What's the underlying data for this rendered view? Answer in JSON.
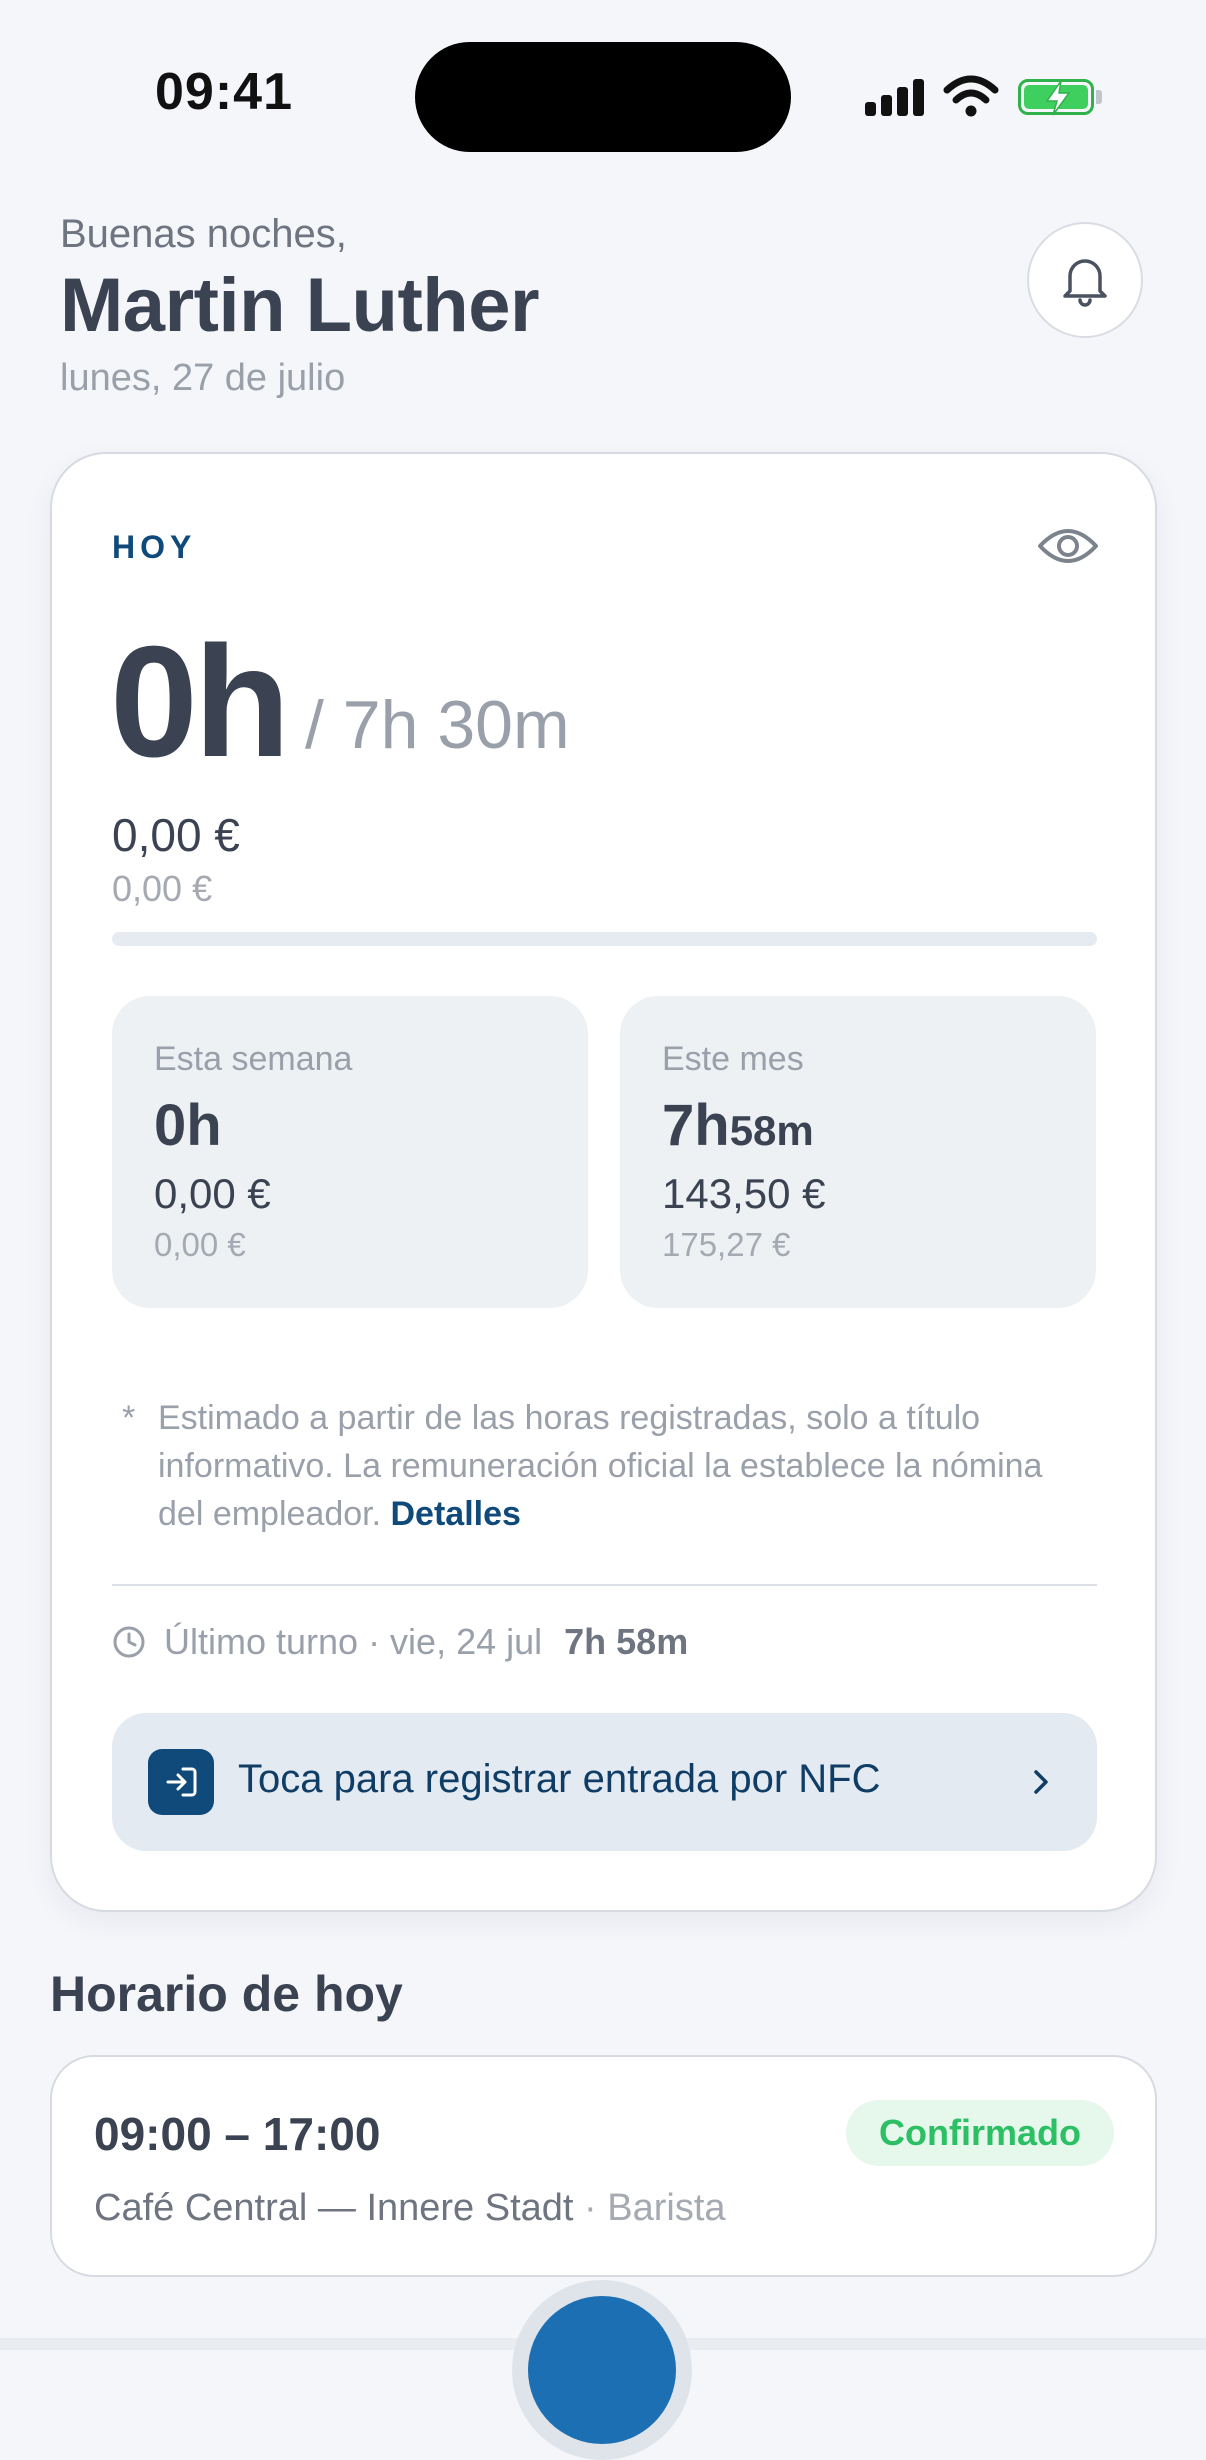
{
  "status_bar": {
    "time": "09:41"
  },
  "header": {
    "greeting": "Buenas noches,",
    "name": "Martin Luther",
    "date": "lunes, 27 de julio"
  },
  "today": {
    "label": "HOY",
    "hours": "0h",
    "target": "/ 7h 30m",
    "earnings": "0,00 €",
    "earnings_secondary": "0,00 €",
    "progress": 0,
    "week": {
      "label": "Esta semana",
      "hours": "0h",
      "earnings": "0,00 €",
      "earnings_secondary": "0,00 €"
    },
    "month": {
      "label": "Este mes",
      "hours_main": "7h",
      "hours_sub": "58m",
      "earnings": "143,50 €",
      "earnings_secondary": "175,27 €"
    },
    "note": {
      "marker": "*",
      "text": "Estimado a partir de las horas registradas, solo a título informativo. La remuneración oficial la establece la nómina del empleador.",
      "link": "Detalles"
    },
    "last_shift": {
      "text": "Último turno · vie, 24 jul",
      "duration": "7h 58m"
    },
    "nfc_action": "Toca para registrar entrada por NFC"
  },
  "schedule": {
    "title": "Horario de hoy",
    "time": "09:00 – 17:00",
    "status": "Confirmado",
    "location": "Café Central — Innere Stadt",
    "role": "· Barista"
  },
  "colors": {
    "accent": "#0f4a7a",
    "confirmed": "#2cbf63",
    "background": "#f4f6fa"
  }
}
